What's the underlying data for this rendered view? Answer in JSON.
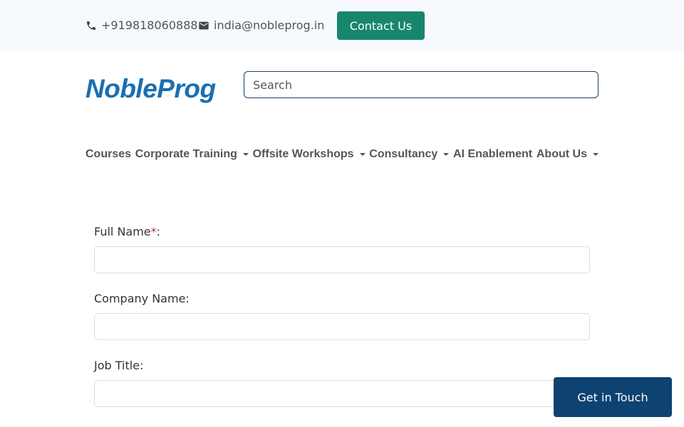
{
  "topbar": {
    "phone": "+919818060888",
    "email": "india@nobleprog.in",
    "contact_label": "Contact Us"
  },
  "header": {
    "logo_text": "NobleProg",
    "search_placeholder": "Search"
  },
  "nav": {
    "items": [
      {
        "label": "Courses"
      },
      {
        "label": "Corporate Training"
      },
      {
        "label": "Offsite Workshops"
      },
      {
        "label": "Consultancy"
      },
      {
        "label": "AI Enablement"
      },
      {
        "label": "About Us"
      }
    ]
  },
  "form": {
    "full_name_label": "Full Name",
    "required_mark": "*",
    "full_name_suffix": ":",
    "company_label": "Company Name:",
    "job_title_label": "Job Title:"
  },
  "floating": {
    "get_in_touch": "Get in Touch"
  },
  "colors": {
    "accent_green": "#18866c",
    "brand_blue": "#1b6fb0",
    "navy": "#0e4270"
  }
}
